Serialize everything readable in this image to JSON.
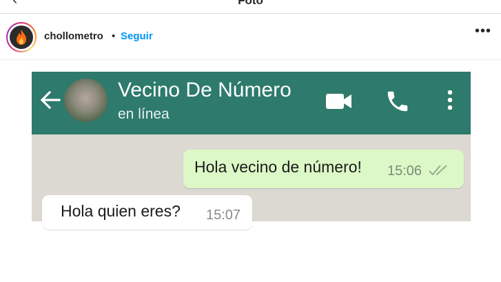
{
  "topbar": {
    "title": "Foto"
  },
  "post": {
    "username": "chollometro",
    "separator": "•",
    "follow_label": "Seguir",
    "more_icon": "more-horizontal-icon"
  },
  "whatsapp": {
    "header_color": "#2e7a6c",
    "contact_name": "Vecino De Número",
    "status": "en línea",
    "icons": [
      "back-arrow-icon",
      "video-call-icon",
      "phone-call-icon",
      "more-vertical-icon"
    ],
    "messages": [
      {
        "direction": "outgoing",
        "text": "Hola vecino de número!",
        "time": "15:06",
        "status_icon": "double-check-icon"
      },
      {
        "direction": "incoming",
        "text": "Hola quien eres?",
        "time": "15:07"
      }
    ]
  },
  "colors": {
    "follow": "#0095f6",
    "outgoing_bubble": "#dcf8c6",
    "chat_background": "#dcd8d2"
  }
}
